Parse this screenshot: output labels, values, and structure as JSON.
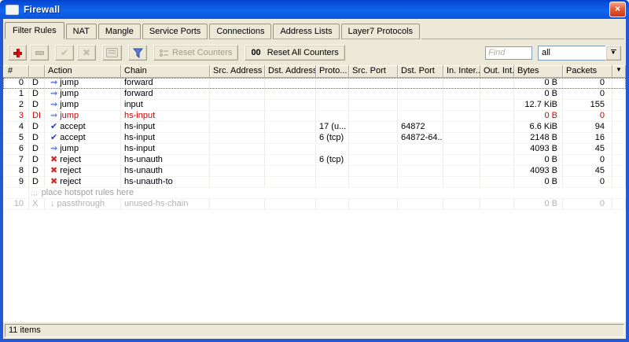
{
  "window": {
    "title": "Firewall"
  },
  "tabs": [
    {
      "label": "Filter Rules",
      "active": true
    },
    {
      "label": "NAT",
      "active": false
    },
    {
      "label": "Mangle",
      "active": false
    },
    {
      "label": "Service Ports",
      "active": false
    },
    {
      "label": "Connections",
      "active": false
    },
    {
      "label": "Address Lists",
      "active": false
    },
    {
      "label": "Layer7 Protocols",
      "active": false
    }
  ],
  "toolbar": {
    "reset_counters_label": "Reset Counters",
    "reset_all_prefix": "00",
    "reset_all_label": "Reset All Counters",
    "find_placeholder": "Find",
    "filter_selected": "all"
  },
  "table": {
    "columns": [
      "#",
      "",
      "Action",
      "Chain",
      "Src. Address",
      "Dst. Address",
      "Proto...",
      "Src. Port",
      "Dst. Port",
      "In. Inter...",
      "Out. Int...",
      "Bytes",
      "Packets",
      ""
    ],
    "rows": [
      {
        "num": "0",
        "flags": "D",
        "action": "jump",
        "chain": "forward",
        "protocol": "",
        "src_port": "",
        "dst_port": "",
        "in_interface": "",
        "out_interface": "",
        "bytes": "0 B",
        "packets": "0",
        "state": "selected"
      },
      {
        "num": "1",
        "flags": "D",
        "action": "jump",
        "chain": "forward",
        "protocol": "",
        "src_port": "",
        "dst_port": "",
        "in_interface": "",
        "out_interface": "",
        "bytes": "0 B",
        "packets": "0"
      },
      {
        "num": "2",
        "flags": "D",
        "action": "jump",
        "chain": "input",
        "protocol": "",
        "src_port": "",
        "dst_port": "",
        "in_interface": "",
        "out_interface": "",
        "bytes": "12.7 KiB",
        "packets": "155"
      },
      {
        "num": "3",
        "flags": "DI",
        "action": "jump",
        "chain": "hs-input",
        "protocol": "",
        "src_port": "",
        "dst_port": "",
        "in_interface": "",
        "out_interface": "",
        "bytes": "0 B",
        "packets": "0",
        "state": "invalid"
      },
      {
        "num": "4",
        "flags": "D",
        "action": "accept",
        "chain": "hs-input",
        "protocol": "17 (u...",
        "src_port": "",
        "dst_port": "64872",
        "in_interface": "",
        "out_interface": "",
        "bytes": "6.6 KiB",
        "packets": "94"
      },
      {
        "num": "5",
        "flags": "D",
        "action": "accept",
        "chain": "hs-input",
        "protocol": "6 (tcp)",
        "src_port": "",
        "dst_port": "64872-64...",
        "in_interface": "",
        "out_interface": "",
        "bytes": "2148 B",
        "packets": "16"
      },
      {
        "num": "6",
        "flags": "D",
        "action": "jump",
        "chain": "hs-input",
        "protocol": "",
        "src_port": "",
        "dst_port": "",
        "in_interface": "",
        "out_interface": "",
        "bytes": "4093 B",
        "packets": "45"
      },
      {
        "num": "7",
        "flags": "D",
        "action": "reject",
        "chain": "hs-unauth",
        "protocol": "6 (tcp)",
        "src_port": "",
        "dst_port": "",
        "in_interface": "",
        "out_interface": "",
        "bytes": "0 B",
        "packets": "0"
      },
      {
        "num": "8",
        "flags": "D",
        "action": "reject",
        "chain": "hs-unauth",
        "protocol": "",
        "src_port": "",
        "dst_port": "",
        "in_interface": "",
        "out_interface": "",
        "bytes": "4093 B",
        "packets": "45"
      },
      {
        "num": "9",
        "flags": "D",
        "action": "reject",
        "chain": "hs-unauth-to",
        "protocol": "",
        "src_port": "",
        "dst_port": "",
        "in_interface": "",
        "out_interface": "",
        "bytes": "0 B",
        "packets": "0"
      },
      {
        "type": "comment",
        "marker": ";;;",
        "text": "place hotspot rules here"
      },
      {
        "num": "10",
        "flags": "X",
        "action": "passthrough",
        "chain": "unused-hs-chain",
        "protocol": "",
        "src_port": "",
        "dst_port": "",
        "in_interface": "",
        "out_interface": "",
        "bytes": "0 B",
        "packets": "0",
        "state": "disabled"
      }
    ]
  },
  "statusbar": {
    "items": "11 items"
  },
  "colors": {
    "titlebar_top": "#0443cf",
    "titlebar_bottom": "#0b55dd",
    "face": "#ece9d8",
    "invalid_red": "#d40000",
    "disabled_gray": "#b3b3b3",
    "jump_blue": "#5b79d6",
    "accept_blue": "#2b3fb0",
    "reject_red": "#d42a2a"
  }
}
